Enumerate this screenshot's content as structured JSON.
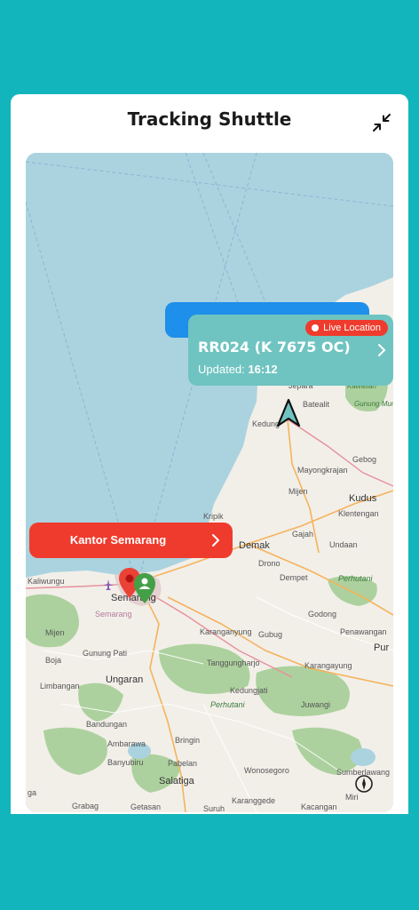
{
  "header": {
    "title": "Tracking Shuttle"
  },
  "vehicle": {
    "badge": "Live Location",
    "plate": "RR024 (K 7675 OC)",
    "updated_label": "Updated:",
    "updated_time": "16:12"
  },
  "office": {
    "label": "Kantor Semarang"
  },
  "map_labels": {
    "jepara": "Jepara",
    "batealit": "Batealit",
    "kedung": "Kedung",
    "gebog": "Gebog",
    "mayong": "Mayongkrajan",
    "mijen": "Mijen",
    "kudus": "Kudus",
    "klentengan": "Klentengan",
    "kripik": "Kripik",
    "gajah": "Gajah",
    "undaan": "Undaan",
    "demak": "Demak",
    "drono": "Drono",
    "dempet": "Dempet",
    "kaliwungu": "Kaliwungu",
    "semarang": "Semarang",
    "semarang2": "Semarang",
    "perhutani1": "Perhutani",
    "godong": "Godong",
    "penawangan": "Penawangan",
    "pur": "Pur",
    "mijen2": "Mijen",
    "karanganyung": "Karanganyung",
    "gubug": "Gubug",
    "boja": "Boja",
    "gunungpati": "Gunung Pati",
    "tanggungharjo": "Tanggungharjo",
    "karangayung": "Karangayung",
    "limbangan": "Limbangan",
    "ungaran": "Ungaran",
    "kedungjati": "Kedungjati",
    "perhutani2": "Perhutani",
    "juwangi": "Juwangi",
    "bandungan": "Bandungan",
    "ambarawa": "Ambarawa",
    "bringin": "Bringin",
    "banyubiru": "Banyubiru",
    "pabelan": "Pabelan",
    "wonosegoro": "Wonosegoro",
    "sumberlawang": "Sumberlawang",
    "salatiga": "Salatiga",
    "miri": "Miri",
    "grabag": "Grabag",
    "getasan": "Getasan",
    "suruh": "Suruh",
    "karanggede": "Karanggede",
    "kacangan": "Kacangan",
    "kawasan": "Kawasan",
    "muria": "Gunung Muria",
    "ga": "ga"
  },
  "colors": {
    "sea": "#aad3df",
    "land": "#f2efe9",
    "forest": "#add19e",
    "accent_teal": "#13b5bc",
    "live_red": "#ef3b2d",
    "card_teal": "#6fc4c1",
    "tab_blue": "#1e8fea"
  },
  "icons": {
    "collapse": "collapse-arrows-icon",
    "vehicle": "navigation-arrow-icon",
    "office_marker": "red-location-pin-icon",
    "user_marker": "green-user-pin-icon",
    "compass": "compass-icon"
  }
}
